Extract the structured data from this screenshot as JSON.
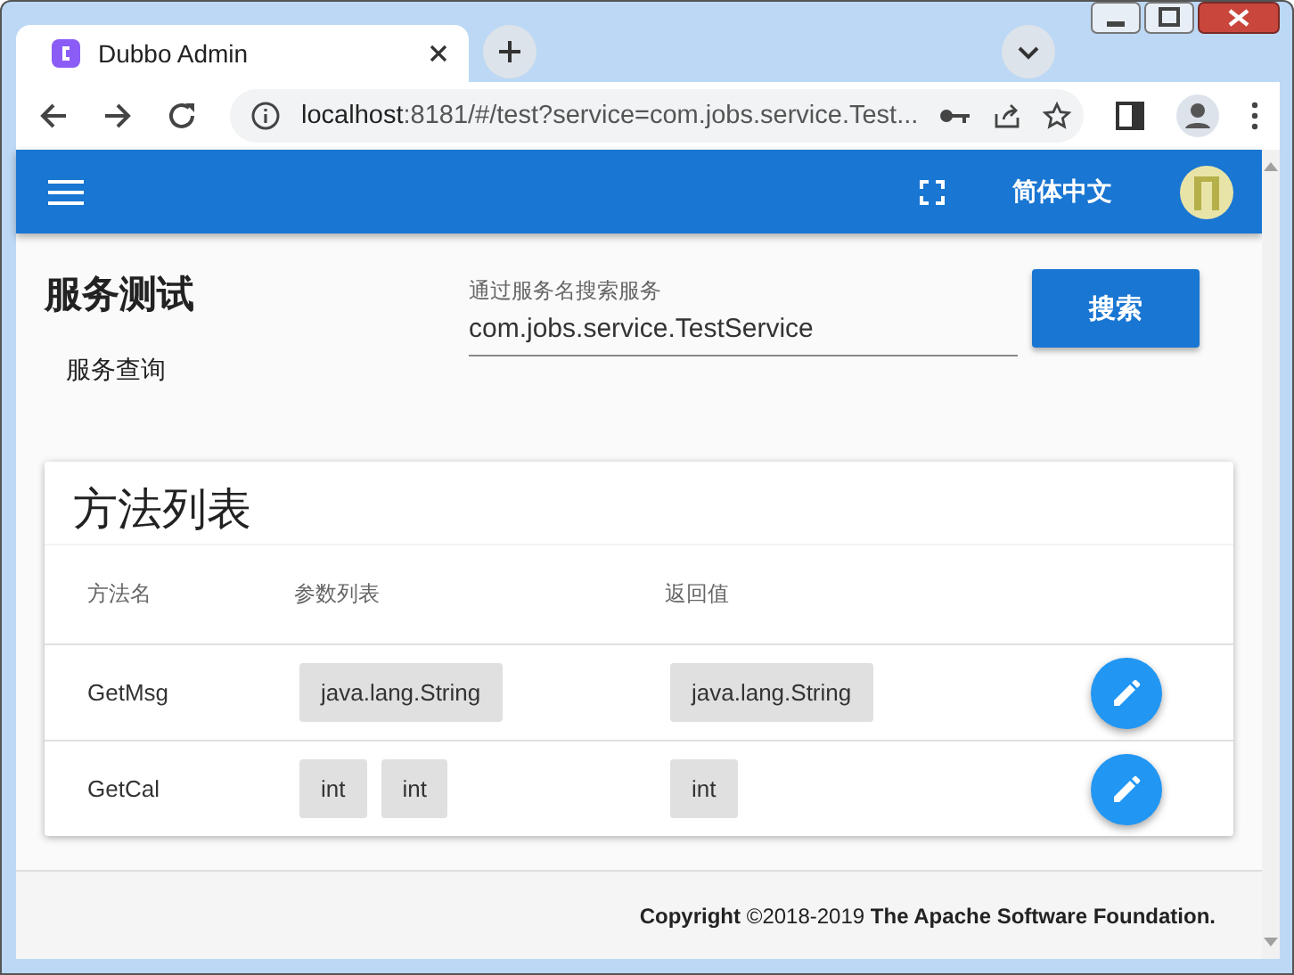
{
  "browser": {
    "tab_title": "Dubbo Admin",
    "url_host": "localhost",
    "url_rest": ":8181/#/test?service=com.jobs.service.Test..."
  },
  "toolbar": {
    "language": "简体中文"
  },
  "page": {
    "title": "服务测试",
    "subtitle": "服务查询",
    "search": {
      "label": "通过服务名搜索服务",
      "value": "com.jobs.service.TestService"
    },
    "search_button": "搜索"
  },
  "table": {
    "title": "方法列表",
    "columns": [
      "方法名",
      "参数列表",
      "返回值"
    ],
    "rows": [
      {
        "name": "GetMsg",
        "params": [
          "java.lang.String"
        ],
        "returns": "java.lang.String"
      },
      {
        "name": "GetCal",
        "params": [
          "int",
          "int"
        ],
        "returns": "int"
      }
    ]
  },
  "footer": "**Copyright** ©2018-2019 **The Apache Software Foundation.**"
}
